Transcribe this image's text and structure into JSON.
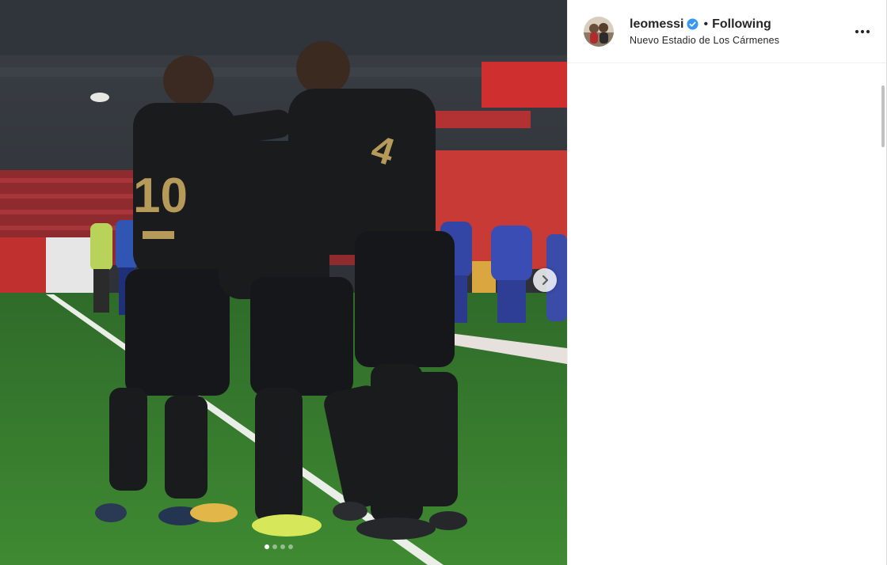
{
  "post": {
    "author": {
      "username": "leomessi",
      "verified": true,
      "follow_status": "Following",
      "separator": "•",
      "location": "Nuevo Estadio de Los Cármenes"
    },
    "media": {
      "carousel_total": 4,
      "carousel_active": 1,
      "icon_next": "chevron-right-icon"
    },
    "header": {
      "more_icon": "more-options-icon"
    }
  },
  "colors": {
    "verified_blue": "#3897f0",
    "text": "#262626"
  }
}
